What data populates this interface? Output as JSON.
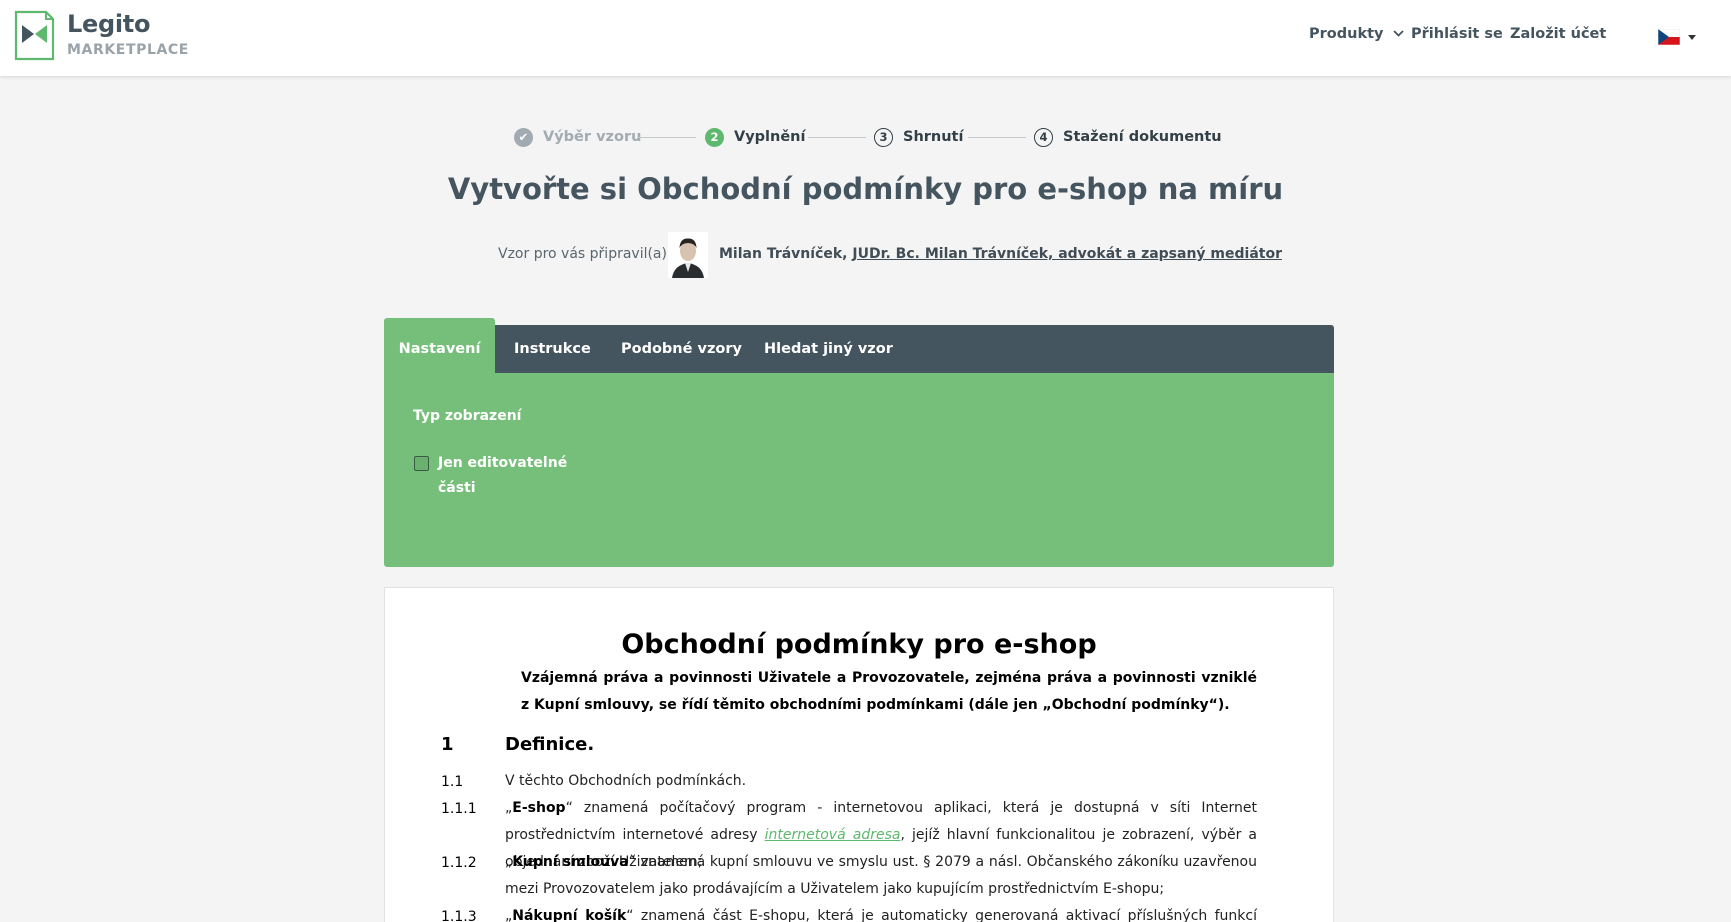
{
  "header": {
    "brand_name": "Legito",
    "brand_sub": "MARKETPLACE",
    "nav_produkty": "Produkty",
    "nav_login": "Přihlásit se",
    "nav_register": "Založit účet"
  },
  "stepper": {
    "steps": [
      {
        "number": "✔",
        "label": "Výběr vzoru"
      },
      {
        "number": "2",
        "label": "Vyplnění"
      },
      {
        "number": "3",
        "label": "Shrnutí"
      },
      {
        "number": "4",
        "label": "Stažení dokumentu"
      }
    ]
  },
  "page_title": "Vytvořte si Obchodní podmínky pro e-shop na míru",
  "author": {
    "label": "Vzor pro vás připravil(a):",
    "name": "Milan Trávníček,",
    "link": "JUDr. Bc. Milan Trávníček, advokát a zapsaný mediátor"
  },
  "tabs": [
    "Nastavení",
    "Instrukce",
    "Podobné vzory",
    "Hledat jiný vzor"
  ],
  "settings": {
    "heading": "Typ zobrazení",
    "checkbox_label": "Jen editovatelné části",
    "checkbox_checked": false
  },
  "document": {
    "title": "Obchodní podmínky pro e-shop",
    "intro": "Vzájemná práva a povinnosti Uživatele a Provozovatele, zejména práva a povinnosti vzniklé z Kupní smlouvy, se řídí těmito obchodními podmínkami (dále jen „Obchodní podmínky“).",
    "section_num": "1",
    "section_title": "Definice.",
    "clauses": [
      {
        "num": "1.1",
        "text": "V těchto Obchodních podmínkách."
      },
      {
        "num": "1.1.1",
        "open": "„",
        "term": "E-shop",
        "text_a": "“ znamená počítačový program - internetovou aplikaci, která je dostupná v síti Internet prostřednictvím internetové adresy ",
        "editable": "internetová adresa",
        "text_b": ", jejíž hlavní funkcionalitou je zobrazení, výběr a objednání zboží Uživatelem;"
      },
      {
        "num": "1.1.2",
        "open": "„",
        "term": "Kupní smlouva",
        "text": "“ znamená kupní smlouvu ve smyslu ust. § 2079 a násl. Občanského zákoníku uzavřenou mezi Provozovatelem jako prodávajícím a Uživatelem jako kupujícím prostřednictvím E-shopu;"
      },
      {
        "num": "1.1.3",
        "open": "„",
        "term": "Nákupní košík",
        "text": "“ znamená část E-shopu, která je automaticky generovaná aktivací příslušných funkcí Uživatelem v rozhraní E-shopu;"
      }
    ]
  },
  "colors": {
    "accent_green": "#76bf7a",
    "dark_slate": "#455560",
    "step_active": "#5eb86d"
  }
}
